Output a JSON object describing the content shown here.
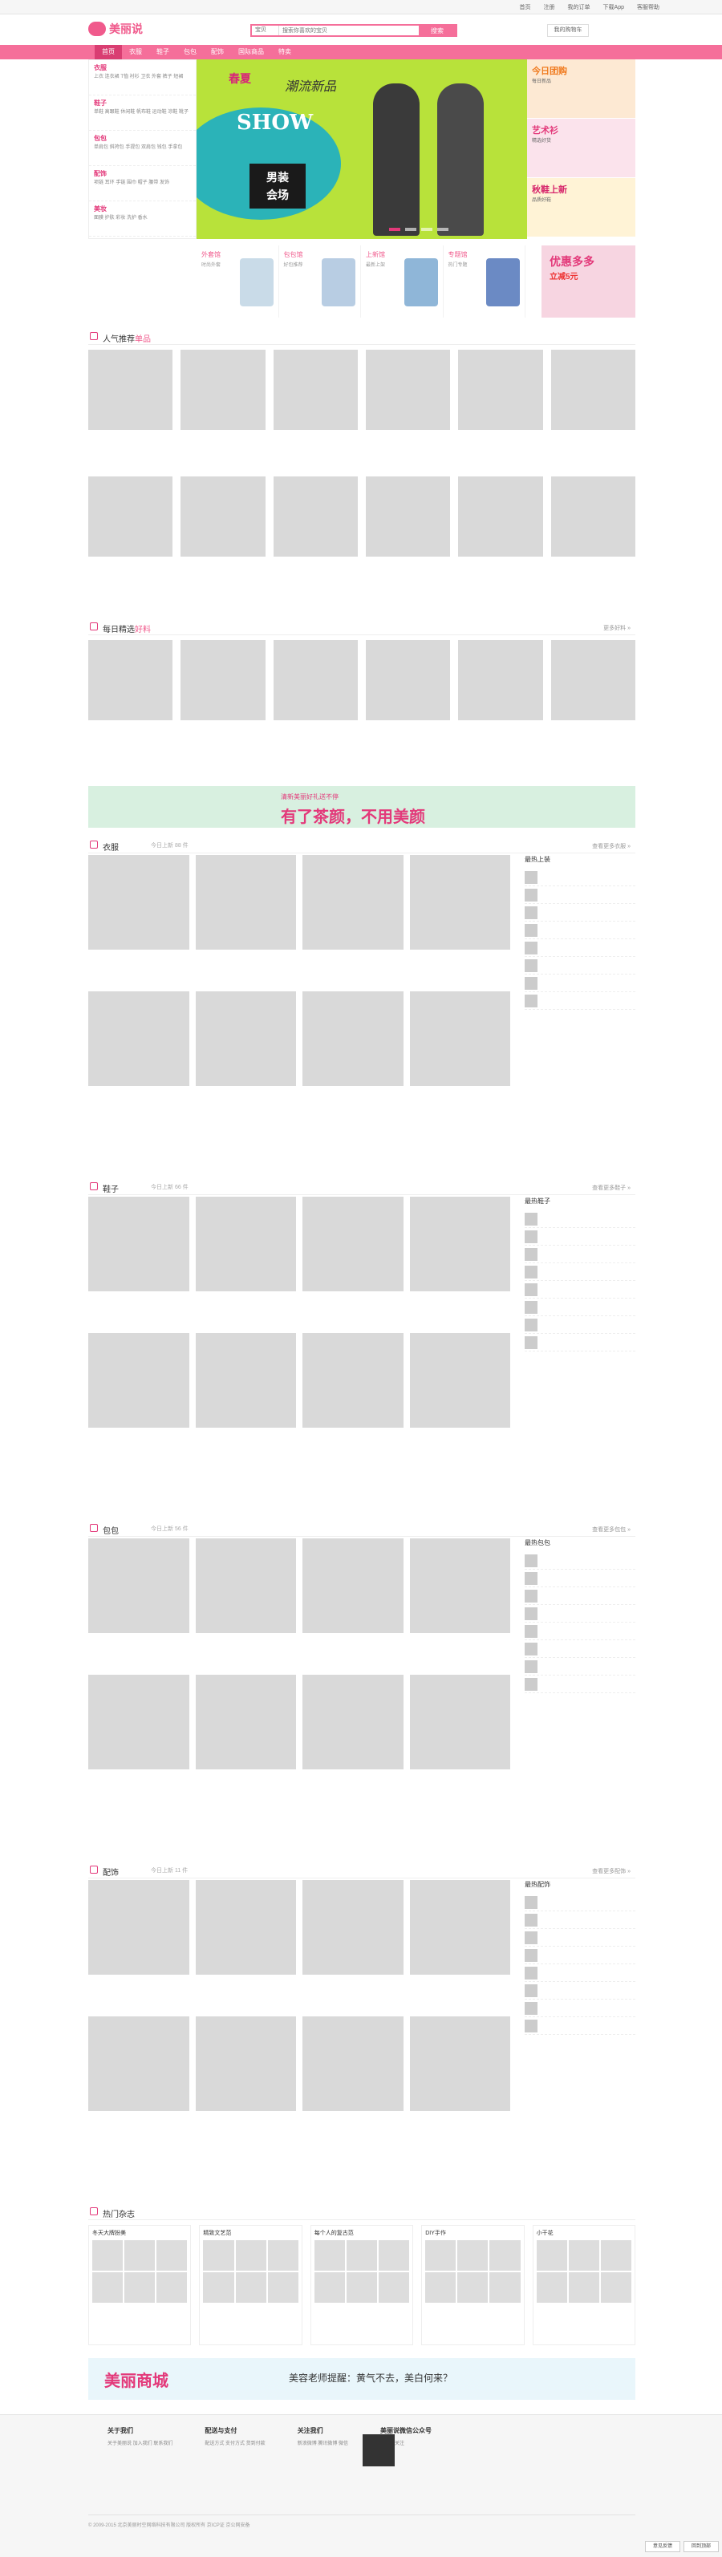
{
  "topbar": {
    "items": [
      "首页",
      "注册",
      "我的订单",
      "下载App",
      "客服帮助"
    ]
  },
  "header": {
    "logo": "美丽说",
    "search_tab": "宝贝",
    "search_placeholder": "搜索你喜欢的宝贝",
    "search_button": "搜索",
    "cart": "我的购物车"
  },
  "nav": {
    "items": [
      "首页",
      "衣服",
      "鞋子",
      "包包",
      "配饰",
      "国际商品",
      "特卖"
    ]
  },
  "categories": [
    {
      "title": "衣服",
      "links": "上衣 连衣裙 T恤 衬衫 卫衣 外套 裤子 短裙"
    },
    {
      "title": "鞋子",
      "links": "单鞋 高跟鞋 休闲鞋 帆布鞋 运动鞋 凉鞋 靴子"
    },
    {
      "title": "包包",
      "links": "单肩包 斜挎包 手提包 双肩包 钱包 手拿包"
    },
    {
      "title": "配饰",
      "links": "项链 耳环 手链 围巾 帽子 腰带 发饰"
    },
    {
      "title": "美妆",
      "links": "面膜 护肤 彩妆 洗护 香水"
    }
  ],
  "slider": {
    "title1": "春夏",
    "title2": "潮流新品",
    "show": "SHOW",
    "badge1": "男装",
    "badge2": "会场"
  },
  "promos": [
    {
      "title": "今日团购",
      "sub": "每日新品"
    },
    {
      "title": "艺术衫",
      "sub": "精选好货"
    },
    {
      "title": "秋鞋上新",
      "sub": "品质好鞋"
    }
  ],
  "sub_banners": [
    {
      "title": "外套馆",
      "sub": "时尚外套"
    },
    {
      "title": "包包馆",
      "sub": "好包推荐"
    },
    {
      "title": "上新馆",
      "sub": "最新上架"
    },
    {
      "title": "专题馆",
      "sub": "热门专题"
    }
  ],
  "adcard": {
    "line1": "优惠多多",
    "line2": "立减5元"
  },
  "sec_hot": {
    "title": "人气推荐",
    "tag": "单品"
  },
  "sec_daily": {
    "title": "每日精选",
    "tag": "好料",
    "more": "更多好料 »"
  },
  "ad1": {
    "line1": "清新美丽好礼送不停",
    "line2": "有了茶颜，不用美颜"
  },
  "sec_clothes": {
    "title": "衣服",
    "sub": "今日上新 88 件",
    "more": "查看更多衣服 »",
    "rank": "最热上装"
  },
  "sec_shoes": {
    "title": "鞋子",
    "sub": "今日上新 66 件",
    "more": "查看更多鞋子 »",
    "rank": "最热鞋子"
  },
  "sec_bags": {
    "title": "包包",
    "sub": "今日上新 56 件",
    "more": "查看更多包包 »",
    "rank": "最热包包"
  },
  "sec_acc": {
    "title": "配饰",
    "sub": "今日上新 11 件",
    "more": "查看更多配饰 »",
    "rank": "最热配饰"
  },
  "sec_topics": {
    "title": "热门杂志"
  },
  "topics": [
    "冬天大牌扮美",
    "精致文艺范",
    "每个人的复古范",
    "DIY手作",
    "小干花"
  ],
  "ad2": {
    "line1": "美丽商城",
    "line2": "美容老师提醒：黄气不去，美白何来？"
  },
  "footer": {
    "cols": [
      {
        "head": "关于我们",
        "links": "关于美丽说 加入我们 联系我们"
      },
      {
        "head": "配送与支付",
        "links": "配送方式 支付方式 货到付款"
      },
      {
        "head": "关注我们",
        "links": "新浪微博 腾讯微博 微信"
      },
      {
        "head": "美丽说微信公众号",
        "links": "扫一扫关注"
      }
    ],
    "copyright": "© 2009-2015 北京美丽时空网络科技有限公司 版权所有 京ICP证 京公网安备"
  },
  "float": {
    "a": "意见反馈",
    "b": "回到顶部"
  }
}
